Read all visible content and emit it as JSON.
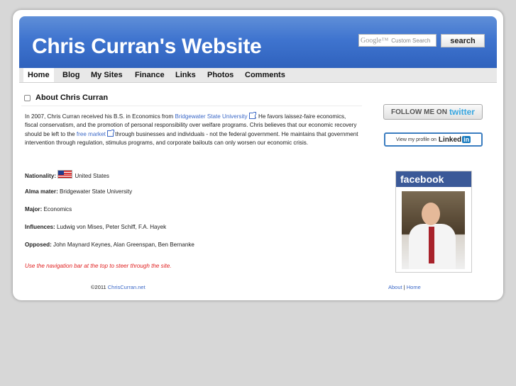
{
  "header": {
    "title": "Chris Curran's Website",
    "search_brand": "Google™",
    "search_placeholder": "Custom Search",
    "search_button": "search"
  },
  "nav": {
    "items": [
      {
        "label": "Home",
        "active": true
      },
      {
        "label": "Blog"
      },
      {
        "label": "My Sites"
      },
      {
        "label": "Finance"
      },
      {
        "label": "Links"
      },
      {
        "label": "Photos"
      },
      {
        "label": "Comments"
      }
    ]
  },
  "about": {
    "heading": "About Chris Curran",
    "intro_1": "In 2007, Chris Curran received his B.S. in Economics from",
    "link_1": "Bridgewater State University",
    "intro_2": ". He favors laissez-faire economics, fiscal conservatism, and the promotion of personal responsibility over welfare programs. Chris believes that our economic recovery should be left to the",
    "link_2": "free market",
    "intro_3": "through businesses and individuals - not the federal government. He maintains that government intervention through regulation, stimulus programs, and corporate bailouts can only worsen our economic crisis.",
    "facts": [
      {
        "label": "Nationality:",
        "value": "United States"
      },
      {
        "label": "Alma mater:",
        "value": "Bridgewater State University"
      },
      {
        "label": "Major:",
        "value": "Economics"
      },
      {
        "label": "Influences:",
        "value": "Ludwig von Mises, Peter Schiff, F.A. Hayek"
      },
      {
        "label": "Opposed:",
        "value": "John Maynard Keynes, Alan Greenspan, Ben Bernanke"
      }
    ],
    "note": "Use the navigation bar at the top to steer through the site."
  },
  "sidebar": {
    "twitter_text": "FOLLOW ME ON",
    "twitter_brand": "twitter",
    "linkedin_text": "View my profile on",
    "linkedin_brand": "Linked",
    "linkedin_in": "in",
    "facebook_brand": "facebook"
  },
  "footer": {
    "copyright": "©2011",
    "site_link": "ChrisCurran.net",
    "about_link": "About",
    "separator": "|",
    "home_link": "Home"
  },
  "colors": {
    "header_blue": "#3f74cf",
    "link": "#3b68c7",
    "note_red": "#e02020",
    "facebook": "#3b5998"
  }
}
